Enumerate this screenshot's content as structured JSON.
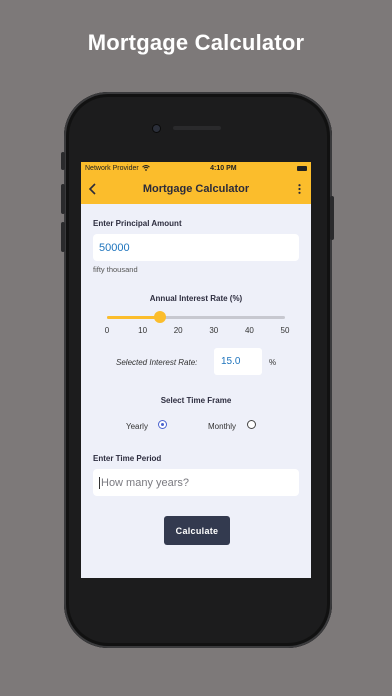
{
  "promo": {
    "title": "Mortgage Calculator"
  },
  "status_bar": {
    "carrier": "Network Provider",
    "time": "4:10 PM"
  },
  "app_bar": {
    "title": "Mortgage Calculator"
  },
  "principal": {
    "label": "Enter Principal Amount",
    "value": "50000",
    "words": "fifty thousand"
  },
  "interest": {
    "label": "Annual Interest Rate (%)",
    "ticks": [
      "0",
      "10",
      "20",
      "30",
      "40",
      "50"
    ],
    "value": 15,
    "min": 0,
    "max": 50,
    "selected_label": "Selected Interest Rate:",
    "selected_value": "15.0",
    "unit": "%"
  },
  "time_frame": {
    "label": "Select Time Frame",
    "options": [
      {
        "label": "Yearly",
        "selected": true
      },
      {
        "label": "Monthly",
        "selected": false
      }
    ]
  },
  "time_period": {
    "label": "Enter Time Period",
    "placeholder": "How many years?"
  },
  "calculate_button": {
    "label": "Calculate"
  },
  "colors": {
    "accent": "#fbbd2c",
    "background": "#eef0f9",
    "button": "#333a4f",
    "value_text": "#1e74bd",
    "radio_selected": "#4a63cf"
  },
  "icons": [
    "back-arrow-icon",
    "more-vert-icon",
    "wifi-icon",
    "battery-icon"
  ]
}
